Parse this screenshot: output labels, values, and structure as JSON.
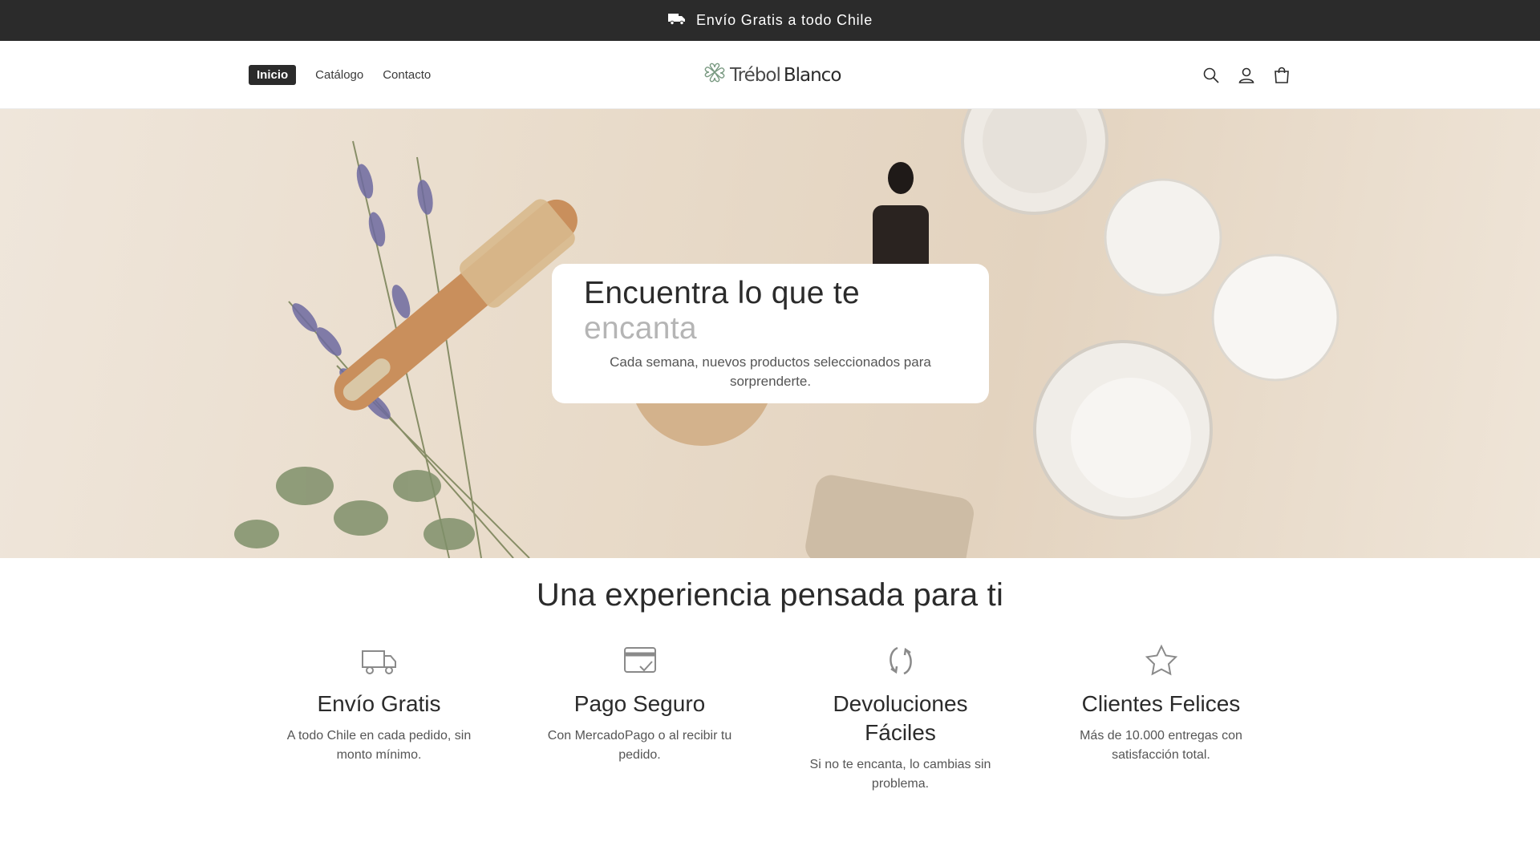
{
  "announcement": {
    "text": "Envío Gratis a todo Chile",
    "icon": "truck-icon"
  },
  "header": {
    "nav": [
      {
        "label": "Inicio",
        "active": true
      },
      {
        "label": "Catálogo",
        "active": false
      },
      {
        "label": "Contacto",
        "active": false
      }
    ],
    "logo": {
      "part1": "Trébol",
      "part2": "Blanco",
      "icon": "clover-icon"
    },
    "icons": [
      "search-icon",
      "account-icon",
      "cart-icon"
    ]
  },
  "hero": {
    "title_main": "Encuentra lo que te",
    "title_accent": "encanta",
    "subtitle": "Cada semana, nuevos productos seleccionados para sorprenderte."
  },
  "features": {
    "title": "Una experiencia pensada para ti",
    "items": [
      {
        "icon": "truck-icon",
        "title": "Envío Gratis",
        "desc": "A todo Chile en cada pedido, sin monto mínimo."
      },
      {
        "icon": "secure-card-icon",
        "title": "Pago Seguro",
        "desc": "Con MercadoPago o al recibir tu pedido."
      },
      {
        "icon": "returns-icon",
        "title": "Devoluciones Fáciles",
        "desc": "Si no te encanta, lo cambias sin problema."
      },
      {
        "icon": "star-icon",
        "title": "Clientes Felices",
        "desc": "Más de 10.000 entregas con satisfacción total."
      }
    ]
  },
  "colors": {
    "dark": "#2b2b2b",
    "accent_light": "#b5b5b5",
    "icon_gray": "#8a8a8a"
  }
}
